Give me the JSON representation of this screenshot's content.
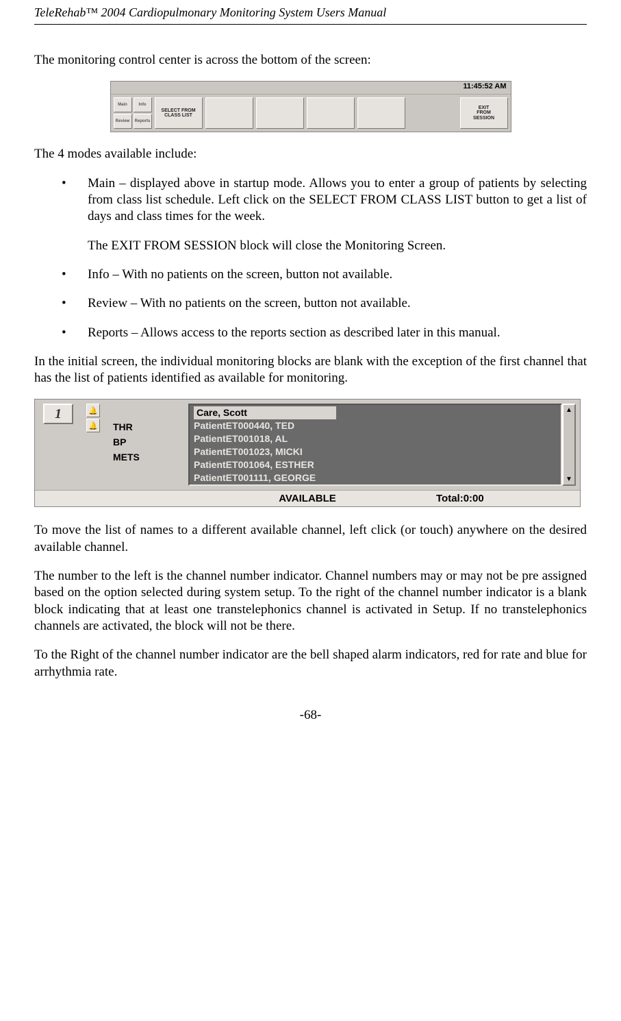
{
  "header": {
    "title": "TeleRehab™ 2004 Cardiopulmonary Monitoring System Users Manual"
  },
  "body": {
    "p1": "The monitoring control center is across the bottom of the screen:",
    "p2": "The 4 modes available include:",
    "bullet1": "Main – displayed above in startup mode. Allows you to enter a group of patients by selecting from class list schedule. Left click on the SELECT FROM CLASS LIST button to get a list of days and class times for the week.",
    "bullet1_sub": "The EXIT FROM SESSION block will close the Monitoring Screen.",
    "bullet2": "Info – With no patients on the screen, button not available.",
    "bullet3": "Review – With no patients on the screen, button not available.",
    "bullet4": "Reports – Allows access to the reports section as described later in this manual.",
    "p3": "In the initial screen, the individual monitoring blocks are blank with the exception of the first channel that has the list of patients identified as available for monitoring.",
    "p4": "To move the list of names to a different available channel, left click (or touch) anywhere on the desired available channel.",
    "p5": "The number to the left is the channel number indicator. Channel numbers may or may not be pre assigned based on the option selected during system setup. To the right of the channel number indicator is a blank block indicating that at least one transtelephonics channel is activated in Setup. If no transtelephonics channels are activated, the block will not be there.",
    "p6": "To the Right of the channel number indicator are the bell shaped alarm indicators, red for rate and blue for arrhythmia rate."
  },
  "ctrlbar": {
    "clock": "11:45:52 AM",
    "mini": {
      "main": "Main",
      "info": "Info",
      "review": "Review",
      "reports": "Reports"
    },
    "select_label": "SELECT FROM\nCLASS LIST",
    "exit_label": "EXIT\nFROM\nSESSION"
  },
  "channel": {
    "number": "1",
    "labels": {
      "thr": "THR",
      "bp": "BP",
      "mets": "METS"
    },
    "patients": {
      "selected": "Care, Scott",
      "rows": [
        "PatientET000440, TED",
        "PatientET001018, AL",
        "PatientET001023, MICKI",
        "PatientET001064, ESTHER",
        "PatientET001111, GEORGE"
      ]
    },
    "status": "AVAILABLE",
    "total_label": "Total:0:00"
  },
  "footer": {
    "page": "-68-"
  }
}
